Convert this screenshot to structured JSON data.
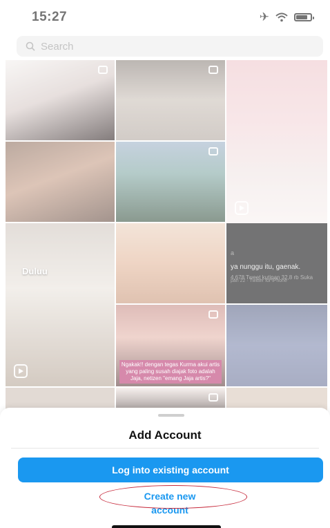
{
  "status_bar": {
    "time": "15:27"
  },
  "search": {
    "placeholder": "Search"
  },
  "grid": {
    "tile6_label": "Duluu",
    "tweet": {
      "line1": "a",
      "text": "ya nunggu itu, gaenak.",
      "meta": "pan 22 · Twitter for iPhone",
      "stats": "4,678 Tweet kutipan 32,8 rb Suka"
    },
    "caption": "Ngakak!! dengan tegas Kurma akui artis yang paling susah diajak foto adalah Jaja, netizen \"emang Jaja artis?\""
  },
  "sheet": {
    "title": "Add Account",
    "login_label": "Log into existing account",
    "create_label": "Create new account"
  },
  "colors": {
    "accent": "#1a98f0",
    "highlight_ring": "#c6283a"
  }
}
